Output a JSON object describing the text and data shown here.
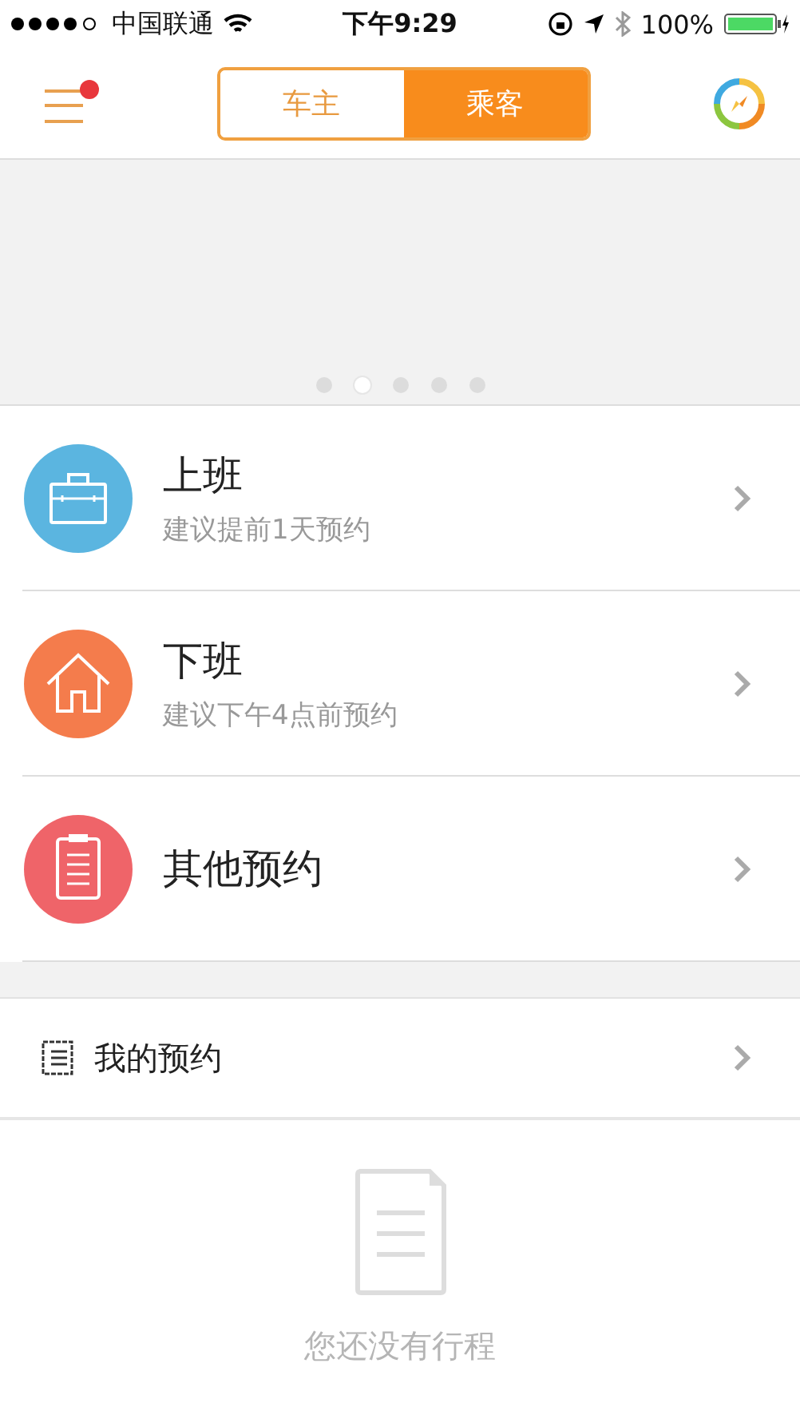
{
  "status_bar": {
    "carrier": "中国联通",
    "time": "下午9:29",
    "battery": "100%"
  },
  "nav": {
    "menu_badge": true,
    "tabs": [
      {
        "label": "车主",
        "selected": false
      },
      {
        "label": "乘客",
        "selected": true
      }
    ]
  },
  "banner": {
    "dots": [
      {
        "selected": false
      },
      {
        "selected": true
      },
      {
        "selected": false
      },
      {
        "selected": false
      },
      {
        "selected": false
      }
    ]
  },
  "bookings": [
    {
      "kind": "briefcase",
      "color": "#5bb5e0",
      "title": "上班",
      "subtitle": "建议提前1天预约"
    },
    {
      "kind": "house",
      "color": "#f47c4c",
      "title": "下班",
      "subtitle": "建议下午4点前预约"
    },
    {
      "kind": "clipboard",
      "color": "#ef6469",
      "title": "其他预约"
    }
  ],
  "my_bookings": {
    "label": "我的预约"
  },
  "empty_state": {
    "message": "您还没有行程"
  }
}
